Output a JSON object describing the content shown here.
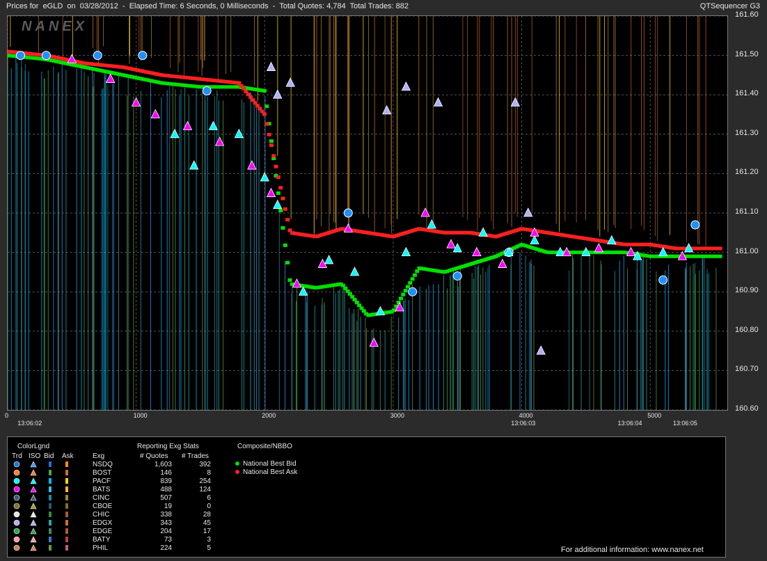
{
  "header": {
    "title": "Prices for  eGLD  on  03/28/2012  -  Elapsed Time: 6 Seconds, 0 Milliseconds  -  Total Quotes: 4,784  Total Trades: 882",
    "app": "QTSequencer G3",
    "logo": "NANEX"
  },
  "chart_data": {
    "type": "scatter",
    "title": "Prices for eGLD on 03/28/2012",
    "xlabel": "",
    "ylabel": "",
    "xlim": [
      0,
      5600
    ],
    "ylim": [
      160.6,
      161.6
    ],
    "grid": true,
    "x_ticks": [
      "0",
      "1000",
      "2000",
      "3000",
      "4000",
      "5000"
    ],
    "x_tick_values": [
      0,
      1000,
      2000,
      3000,
      4000,
      5000
    ],
    "time_ticks": [
      "13:06:02",
      "13:06:03",
      "13:06:04",
      "13:06:05"
    ],
    "time_tick_values": [
      180,
      4020,
      4850,
      5280
    ],
    "y_ticks": [
      "161.60",
      "161.50",
      "161.40",
      "161.30",
      "161.20",
      "161.10",
      "161.00",
      "160.90",
      "160.80",
      "160.70",
      "160.60"
    ],
    "y_tick_values": [
      161.6,
      161.5,
      161.4,
      161.3,
      161.2,
      161.1,
      161.0,
      160.9,
      160.8,
      160.7,
      160.6
    ],
    "series": [
      {
        "name": "National Best Bid",
        "color": "#00e000",
        "x": [
          0,
          300,
          600,
          900,
          1200,
          1500,
          1800,
          2000,
          2200,
          2400,
          2600,
          2800,
          3000,
          3200,
          3400,
          3600,
          3800,
          4000,
          4200,
          4400,
          4600,
          4800,
          5000,
          5200,
          5400,
          5560
        ],
        "y": [
          161.5,
          161.49,
          161.47,
          161.45,
          161.43,
          161.42,
          161.42,
          161.41,
          160.92,
          160.91,
          160.92,
          160.84,
          160.85,
          160.96,
          160.95,
          160.97,
          160.99,
          161.02,
          161.0,
          161.0,
          161.0,
          161.0,
          160.99,
          160.99,
          160.99,
          160.99
        ]
      },
      {
        "name": "National Best Ask",
        "color": "#ff2020",
        "x": [
          0,
          300,
          600,
          900,
          1200,
          1500,
          1800,
          2000,
          2200,
          2400,
          2600,
          2800,
          3000,
          3200,
          3400,
          3600,
          3800,
          4000,
          4200,
          4400,
          4600,
          4800,
          5000,
          5200,
          5400,
          5560
        ],
        "y": [
          161.51,
          161.5,
          161.48,
          161.47,
          161.45,
          161.44,
          161.43,
          161.35,
          161.05,
          161.04,
          161.06,
          161.05,
          161.04,
          161.06,
          161.05,
          161.05,
          161.04,
          161.06,
          161.05,
          161.04,
          161.03,
          161.02,
          161.02,
          161.01,
          161.01,
          161.01
        ]
      },
      {
        "name": "NSDQ",
        "color": "#1e90ff",
        "x": [
          100,
          300,
          700,
          1050,
          1550,
          2650,
          3150,
          3500,
          3900,
          5100,
          5350
        ],
        "y": [
          161.5,
          161.5,
          161.5,
          161.5,
          161.41,
          161.1,
          160.9,
          160.94,
          161.0,
          160.93,
          161.07
        ]
      },
      {
        "name": "PACF",
        "color": "#00ffff",
        "x": [
          1300,
          1450,
          1600,
          1800,
          2000,
          2100,
          2300,
          2500,
          2700,
          2900,
          3100,
          3300,
          3500,
          3700,
          3900,
          4100,
          4300,
          4500,
          4700,
          4900,
          5100,
          5300
        ],
        "y": [
          161.3,
          161.22,
          161.32,
          161.3,
          161.19,
          161.12,
          160.9,
          160.98,
          160.95,
          160.85,
          161.0,
          161.07,
          161.01,
          161.05,
          161.0,
          161.03,
          161.0,
          161.0,
          161.03,
          160.99,
          161.0,
          161.01
        ]
      },
      {
        "name": "BATS",
        "color": "#ff00ff",
        "x": [
          500,
          800,
          1000,
          1150,
          1400,
          1650,
          1900,
          2050,
          2250,
          2450,
          2650,
          2850,
          3050,
          3250,
          3450,
          3650,
          3850,
          4100,
          4350,
          4600,
          4850,
          5250
        ],
        "y": [
          161.49,
          161.44,
          161.38,
          161.35,
          161.32,
          161.28,
          161.22,
          161.15,
          160.92,
          160.97,
          161.06,
          160.77,
          160.86,
          161.1,
          161.02,
          161.0,
          160.97,
          161.05,
          161.0,
          161.01,
          161.0,
          160.99
        ]
      },
      {
        "name": "EDGX",
        "color": "#b0b0ff",
        "x": [
          2050,
          2100,
          2200,
          2950,
          3100,
          3350,
          3950,
          4050,
          4150
        ],
        "y": [
          161.47,
          161.4,
          161.43,
          161.36,
          161.42,
          161.38,
          161.38,
          161.1,
          160.75
        ]
      }
    ]
  },
  "legend": {
    "sections": {
      "color_legend": "ColorLgnd",
      "stats": "Reporting Exg Stats",
      "composite": "Composite/NBBO"
    },
    "headers": {
      "trd": "Trd",
      "iso": "ISO",
      "bid": "Bid",
      "ask": "Ask",
      "exg": "Exg",
      "quotes": "# Quotes",
      "trades": "# Trades"
    },
    "rows": [
      {
        "exg": "NSDQ",
        "quotes": "1,603",
        "trades": "392",
        "trd": "#1e78e0",
        "iso": "#3a9aff",
        "bid": "#1d6fe0",
        "ask": "#ff8c1a"
      },
      {
        "exg": "BOST",
        "quotes": "146",
        "trades": "8",
        "trd": "#ff7f27",
        "iso": "#ff7f27",
        "bid": "#4aa84a",
        "ask": "#d06a40"
      },
      {
        "exg": "PACF",
        "quotes": "839",
        "trades": "254",
        "trd": "#00ffff",
        "iso": "#00ffff",
        "bid": "#00b8ff",
        "ask": "#ffd700"
      },
      {
        "exg": "BATS",
        "quotes": "488",
        "trades": "124",
        "trd": "#ff00ff",
        "iso": "#ff00ff",
        "bid": "#29c6e8",
        "ask": "#ffb347"
      },
      {
        "exg": "CINC",
        "quotes": "507",
        "trades": "6",
        "trd": "#3e5a70",
        "iso": "#3e5a70",
        "bid": "#1f8aa0",
        "ask": "#9e8a2a"
      },
      {
        "exg": "CBOE",
        "quotes": "19",
        "trades": "0",
        "trd": "#7a7a20",
        "iso": "#9aa028",
        "bid": "#205a7a",
        "ask": "#8a6a2a"
      },
      {
        "exg": "CHIC",
        "quotes": "338",
        "trades": "28",
        "trd": "#e6e6e6",
        "iso": "#e6e6e6",
        "bid": "#3a8a3a",
        "ask": "#a06030"
      },
      {
        "exg": "EDGX",
        "quotes": "343",
        "trades": "45",
        "trd": "#b0b0ff",
        "iso": "#b0b0ff",
        "bid": "#2aa8a8",
        "ask": "#d07030"
      },
      {
        "exg": "EDGE",
        "quotes": "204",
        "trades": "17",
        "trd": "#2aa84a",
        "iso": "#2aa84a",
        "bid": "#3a8a6a",
        "ask": "#b05a3a"
      },
      {
        "exg": "BATY",
        "quotes": "73",
        "trades": "3",
        "trd": "#ff9aaa",
        "iso": "#ff9aaa",
        "bid": "#3a7ad0",
        "ask": "#c04040"
      },
      {
        "exg": "PHIL",
        "quotes": "224",
        "trades": "5",
        "trd": "#d08050",
        "iso": "#d08050",
        "bid": "#6a9a3a",
        "ask": "#c06080"
      }
    ],
    "composite_items": [
      {
        "label": "National Best Bid",
        "color": "#00e000"
      },
      {
        "label": "National Best Ask",
        "color": "#ff2020"
      }
    ],
    "footer": "For additional information: www.nanex.net"
  }
}
